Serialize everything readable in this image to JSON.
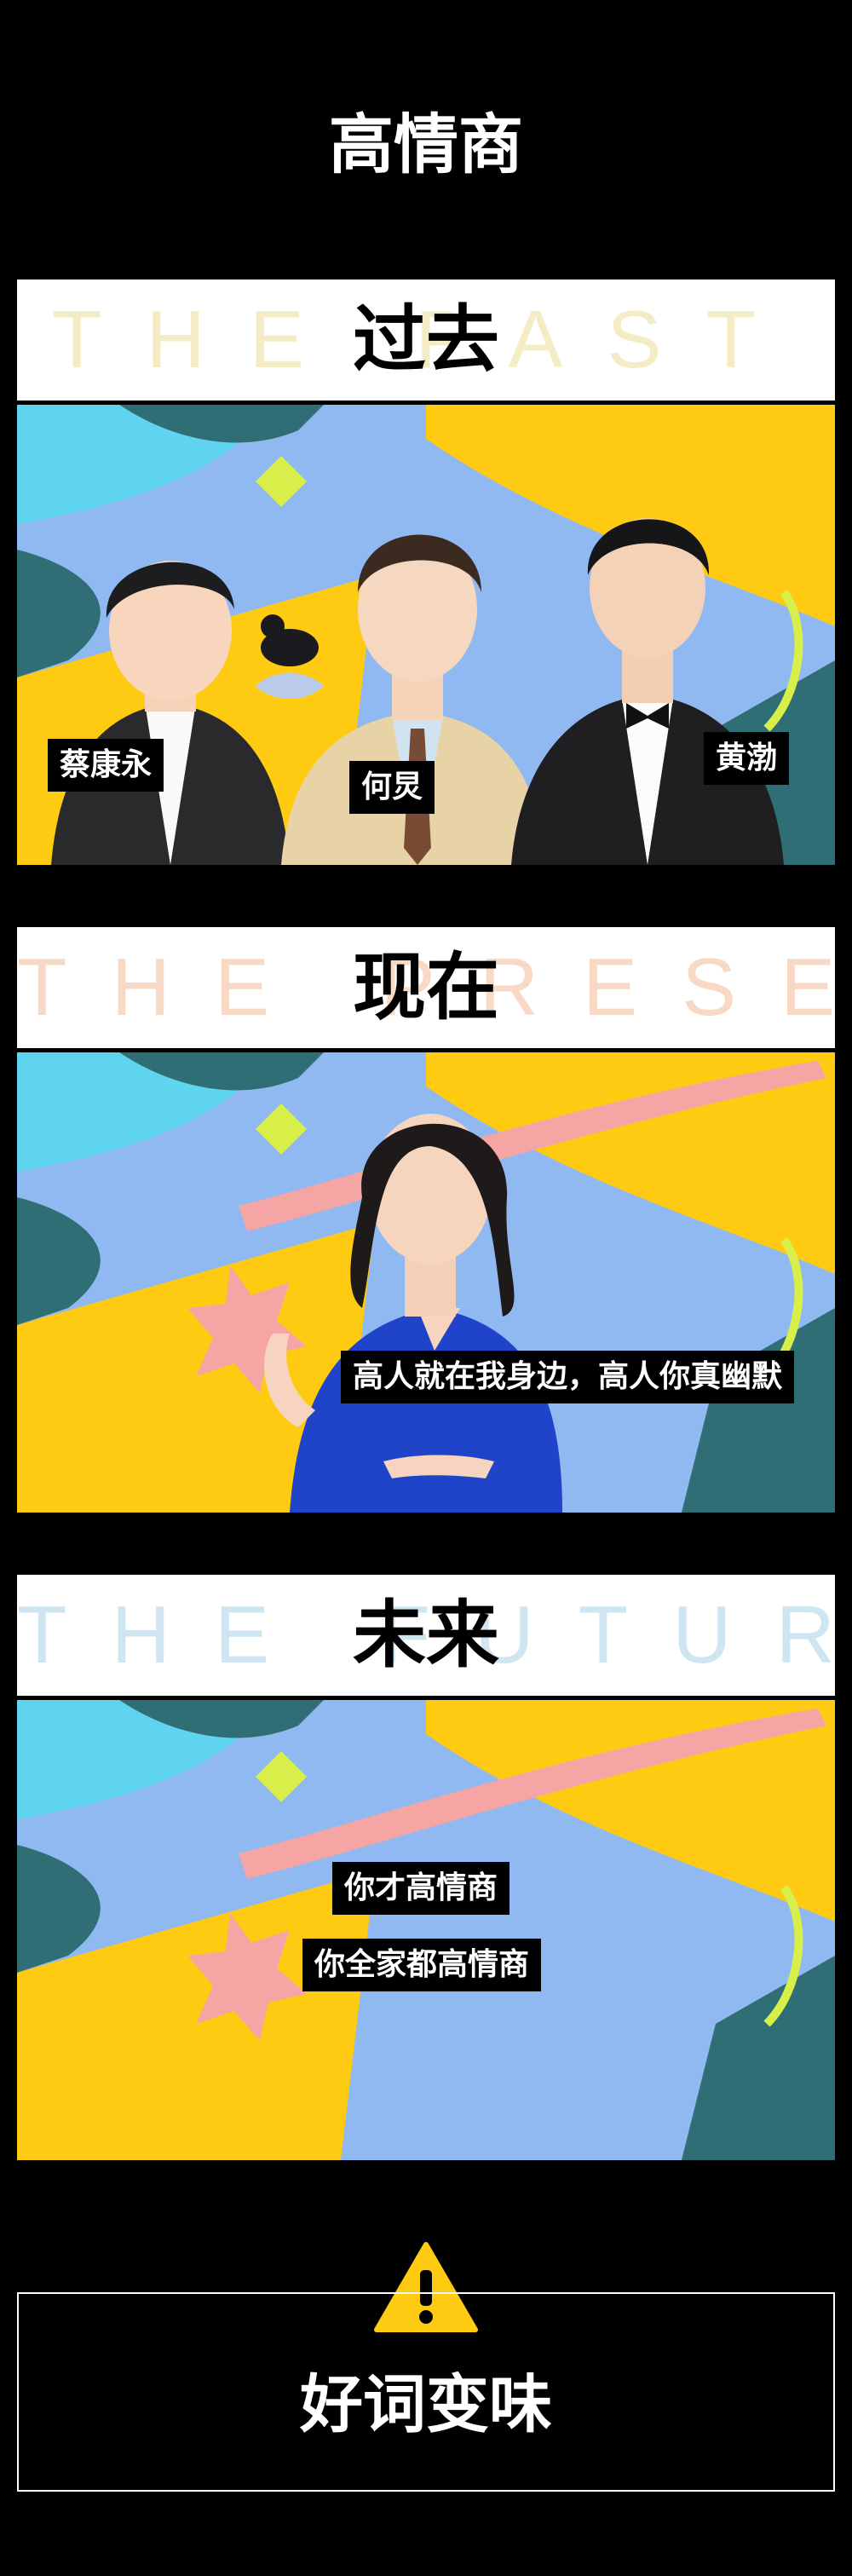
{
  "header": {
    "title": "高情商"
  },
  "sections": [
    {
      "ghost": "THE PAST",
      "title": "过去",
      "ghost_color": "#f4ecc4",
      "labels": [
        "蔡康永",
        "何炅",
        "黄渤"
      ]
    },
    {
      "ghost": "THE PRESENT",
      "title": "现在",
      "ghost_color": "#f8d9c6",
      "labels": [
        "高人就在我身边，高人你真幽默"
      ]
    },
    {
      "ghost": "THE FUTURE",
      "title": "未来",
      "ghost_color": "#cfe6f2",
      "labels": [
        "你才高情商",
        "你全家都高情商"
      ]
    }
  ],
  "footer": {
    "warning_icon": "warning-triangle-icon",
    "text": "好词变味"
  },
  "colors": {
    "yellow": "#ffcb12",
    "blue": "#8fb9f0",
    "cyan": "#5fd4ee",
    "teal": "#2f6e75",
    "pink": "#f5a5a3",
    "lime": "#d8ef4a"
  }
}
